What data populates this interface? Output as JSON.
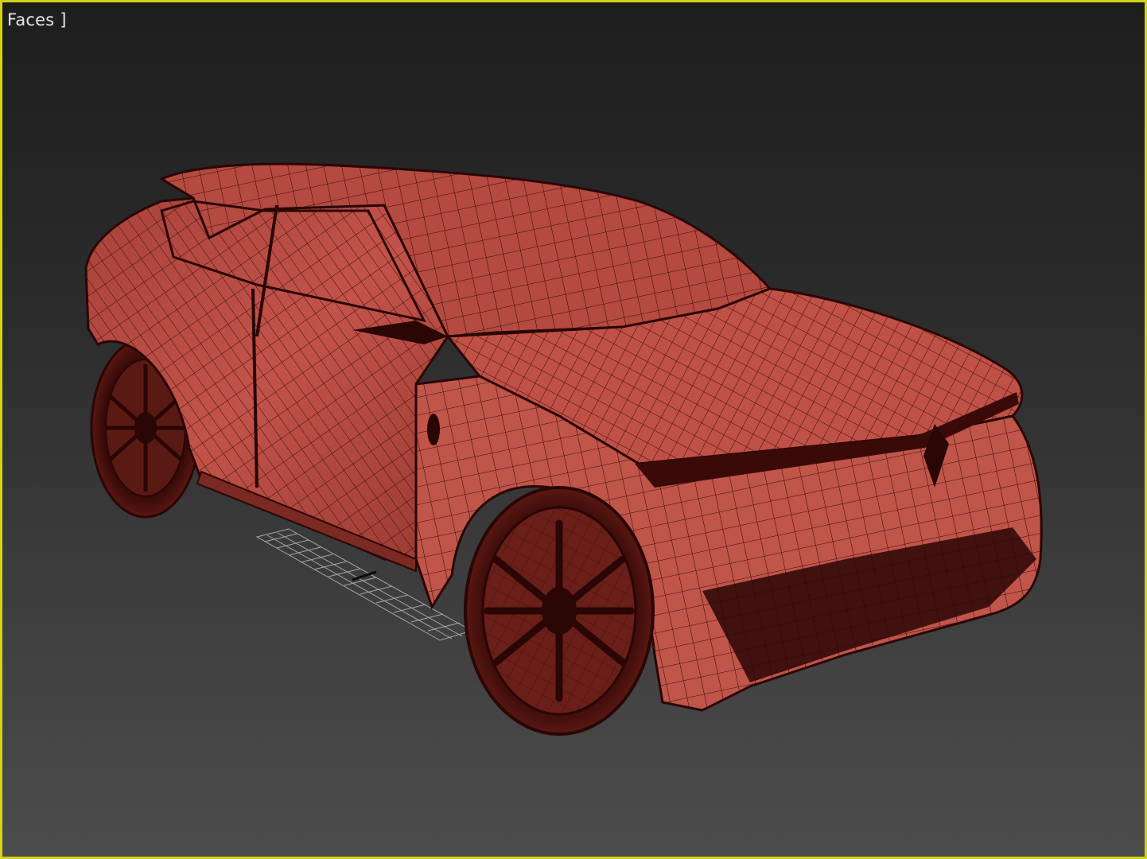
{
  "viewport": {
    "label": "Faces ]",
    "border_color": "#d4d21c",
    "background_top": "#1e1e1e",
    "background_bottom": "#4c4c4c"
  },
  "model": {
    "display_mode": "wireframe-shaded",
    "body_color": "#b84a3f",
    "wire_color": "#3a0a08",
    "shadow_color": "#1a0403",
    "grid_color": "#b8b8b8"
  }
}
